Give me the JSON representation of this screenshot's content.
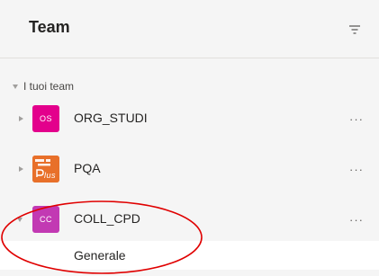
{
  "header": {
    "title": "Team",
    "filter_icon": "filter-icon"
  },
  "section": {
    "label": "I tuoi team",
    "icon": "caret-down-icon"
  },
  "teams": [
    {
      "initials": "OS",
      "name": "ORG_STUDI",
      "avatar_color": "#e3008c",
      "avatar_text_color": "#ffffff"
    },
    {
      "initials": "",
      "name": "PQA",
      "avatar_color": "#e8702a",
      "avatar_logo_text": "Quality is our Plus"
    },
    {
      "initials": "CC",
      "name": "COLL_CPD",
      "avatar_color": "#c239b3",
      "expanded": true
    }
  ],
  "channels": [
    {
      "name": "Generale"
    }
  ],
  "more_label": "···",
  "annotation": {
    "shape": "ellipse",
    "color": "#e00000"
  }
}
